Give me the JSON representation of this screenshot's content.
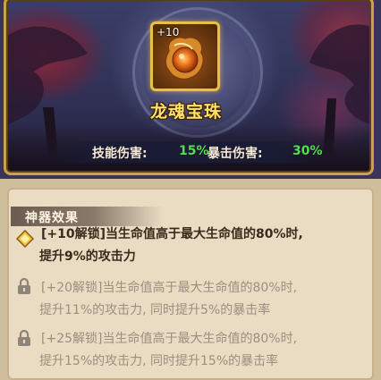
{
  "item": {
    "level": "+10",
    "name": "龙魂宝珠"
  },
  "stats": {
    "skill_damage_label": "技能伤害:",
    "skill_damage_value": "15%",
    "crit_damage_label": "暴击伤害:",
    "crit_damage_value": "30%"
  },
  "effects_section": {
    "title": "神器效果",
    "effects": [
      {
        "status": "unlocked",
        "icon": "diamond-icon",
        "line1": "[+10解锁]当生命值高于最大生命值的80%时,",
        "line2": "提升9%的攻击力"
      },
      {
        "status": "locked",
        "icon": "lock-icon",
        "line1": "[+20解锁]当生命值高于最大生命值的80%时,",
        "line2": "提升11%的攻击力, 同时提升5%的暴击率"
      },
      {
        "status": "locked",
        "icon": "lock-icon",
        "line1": "[+25解锁]当生命值高于最大生命值的80%时,",
        "line2": "提升15%的攻击力, 同时提升15%的暴击率"
      }
    ]
  },
  "colors": {
    "stat_value": "#4fe04f",
    "item_name": "#ffe36a",
    "frame_gold": "#e9bf48",
    "active_text": "#3a2a1c",
    "locked_text": "#9c8e80"
  }
}
